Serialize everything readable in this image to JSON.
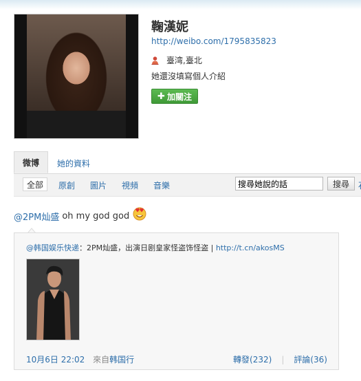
{
  "profile": {
    "name": "鞠漢妮",
    "url": "http://weibo.com/1795835823",
    "location": "臺湾,臺北",
    "bio": "她還沒填寫個人介紹",
    "follow_label": "加關注"
  },
  "tabs": [
    {
      "label": "微博",
      "active": true
    },
    {
      "label": "她的資料",
      "active": false
    }
  ],
  "filters": {
    "all": "全部",
    "original": "原創",
    "pictures": "圖片",
    "videos": "視頻",
    "music": "音樂",
    "search_value": "搜尋她說的話",
    "search_button": "搜尋",
    "edge_char": "石"
  },
  "post": {
    "mention": "@2PM灿盛",
    "text": "oh my god god"
  },
  "repost": {
    "author": "@韩国娱乐快递",
    "separator": "：",
    "text": "2PM灿盛，出演日剧皇家怪盗饰怪盗 | ",
    "link": "http://t.cn/akosMS",
    "time": "10月6日 22:02",
    "from_label": "來自",
    "source": "韩国行",
    "forward": "轉發(232)",
    "sep": "|",
    "comment": "評論(36)"
  },
  "colors": {
    "link": "#2d6eaa",
    "follow_green": "#4caa44"
  }
}
